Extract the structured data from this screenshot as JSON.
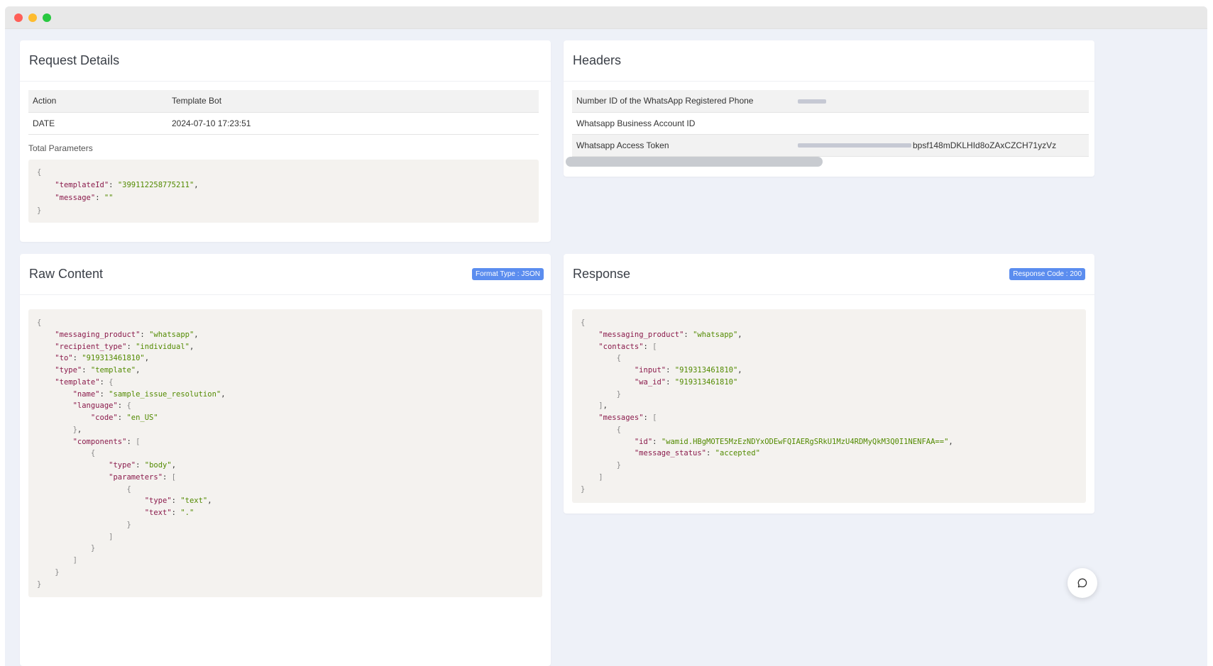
{
  "request_details": {
    "title": "Request Details",
    "rows": [
      {
        "key": "Action",
        "value": "Template Bot"
      },
      {
        "key": "DATE",
        "value": "2024-07-10 17:23:51"
      }
    ],
    "total_parameters_label": "Total Parameters"
  },
  "headers": {
    "title": "Headers",
    "rows": [
      {
        "key": "Number ID of the WhatsApp Registered Phone",
        "value": ""
      },
      {
        "key": "Whatsapp Business Account ID",
        "value": ""
      },
      {
        "key": "Whatsapp Access Token",
        "value": "bpsf148mDKLHId8oZAxCZCH71yzVz"
      }
    ]
  },
  "raw_content": {
    "title": "Raw Content",
    "badge": "Format Type : JSON"
  },
  "response": {
    "title": "Response",
    "badge": "Response Code : 200"
  },
  "colors": {
    "accent": "#5b8def",
    "background": "#eef1f8",
    "code_bg": "#f4f2ef",
    "json_key": "#8a1a4b",
    "json_string": "#528a00"
  },
  "icons": {
    "chat": "chat-bubble-icon"
  }
}
